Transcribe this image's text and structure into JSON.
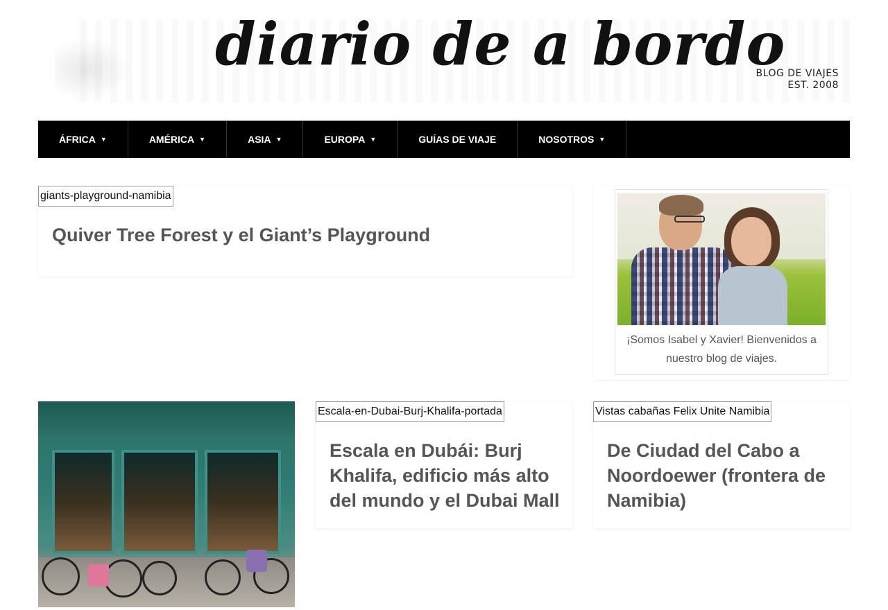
{
  "header": {
    "logo_text": "diario de a bordo",
    "tagline_line1": "BLOG DE VIAJES",
    "tagline_line2": "EST. 2008"
  },
  "nav": {
    "items": [
      {
        "label": "ÁFRICA",
        "has_dropdown": true
      },
      {
        "label": "AMÉRICA",
        "has_dropdown": true
      },
      {
        "label": "ASIA",
        "has_dropdown": true
      },
      {
        "label": "EUROPA",
        "has_dropdown": true
      },
      {
        "label": "GUÍAS DE VIAJE",
        "has_dropdown": false
      },
      {
        "label": "NOSOTROS",
        "has_dropdown": true
      }
    ],
    "caret_icon": "caret-down-icon"
  },
  "posts": [
    {
      "image_alt": "giants-playground-namibia",
      "title": "Quiver Tree Forest y el Giant’s Playground"
    },
    {
      "image_alt": "Escala-en-Dubai-Burj-Khalifa-portada",
      "title": "Escala en Dubái: Burj Khalifa, edificio más alto del mundo y el Dubai Mall"
    },
    {
      "image_alt": "Vistas cabañas Felix Unite Namibia",
      "title": "De Ciudad del Cabo a Noordoewer (frontera de Namibia)"
    }
  ],
  "sidebar": {
    "caption": "¡Somos Isabel y Xavier! Bienvenidos a nuestro blog de viajes."
  },
  "colors": {
    "nav_bg": "#000000",
    "nav_text": "#ffffff",
    "title_text": "#555555"
  }
}
